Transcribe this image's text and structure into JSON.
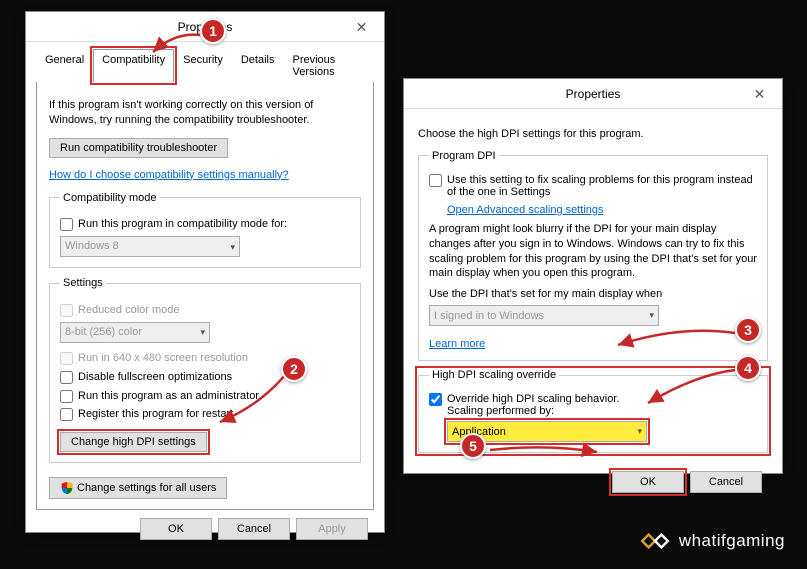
{
  "dialog1": {
    "title": "Properties",
    "tabs": [
      "General",
      "Compatibility",
      "Security",
      "Details",
      "Previous Versions"
    ],
    "active_tab": 1,
    "intro": "If this program isn't working correctly on this version of Windows, try running the compatibility troubleshooter.",
    "troubleshoot_btn": "Run compatibility troubleshooter",
    "manual_link": "How do I choose compatibility settings manually?",
    "compat_mode": {
      "legend": "Compatibility mode",
      "checkbox": "Run this program in compatibility mode for:",
      "select": "Windows 8"
    },
    "settings": {
      "legend": "Settings",
      "reduced_color": "Reduced color mode",
      "color_select": "8-bit (256) color",
      "run_640": "Run in 640 x 480 screen resolution",
      "disable_fullscreen": "Disable fullscreen optimizations",
      "run_admin": "Run this program as an administrator",
      "register_restart": "Register this program for restart",
      "change_dpi_btn": "Change high DPI settings"
    },
    "change_all_users_btn": "Change settings for all users",
    "ok": "OK",
    "cancel": "Cancel",
    "apply": "Apply"
  },
  "dialog2": {
    "title": "Properties",
    "intro": "Choose the high DPI settings for this program.",
    "program_dpi": {
      "legend": "Program DPI",
      "checkbox": "Use this setting to fix scaling problems for this program instead of the one in Settings",
      "adv_link": "Open Advanced scaling settings",
      "para": "A program might look blurry if the DPI for your main display changes after you sign in to Windows. Windows can try to fix this scaling problem for this program by using the DPI that's set for your main display when you open this program.",
      "use_label": "Use the DPI that's set for my main display when",
      "when_select": "I signed in to Windows",
      "learn_more": "Learn more"
    },
    "override": {
      "legend": "High DPI scaling override",
      "checkbox_l1": "Override high DPI scaling behavior.",
      "checkbox_l2": "Scaling performed by:",
      "select": "Application"
    },
    "ok": "OK",
    "cancel": "Cancel"
  },
  "badges": {
    "b1": "1",
    "b2": "2",
    "b3": "3",
    "b4": "4",
    "b5": "5"
  },
  "logo_text": "whatifgaming"
}
